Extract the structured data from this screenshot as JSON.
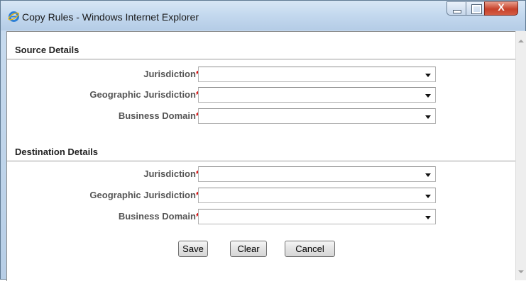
{
  "window": {
    "title": "Copy Rules - Windows Internet Explorer",
    "controls": {
      "close_label": "X"
    }
  },
  "source": {
    "heading": "Source Details",
    "fields": [
      {
        "label": "Jurisdiction",
        "value": ""
      },
      {
        "label": "Geographic Jurisdiction",
        "value": ""
      },
      {
        "label": "Business Domain",
        "value": ""
      }
    ]
  },
  "destination": {
    "heading": "Destination Details",
    "fields": [
      {
        "label": "Jurisdiction",
        "value": ""
      },
      {
        "label": "Geographic Jurisdiction",
        "value": ""
      },
      {
        "label": "Business Domain",
        "value": ""
      }
    ]
  },
  "required_marker": "*",
  "buttons": {
    "save": "Save",
    "clear": "Clear",
    "cancel": "Cancel"
  },
  "colors": {
    "required": "#d40000",
    "label": "#555555"
  }
}
